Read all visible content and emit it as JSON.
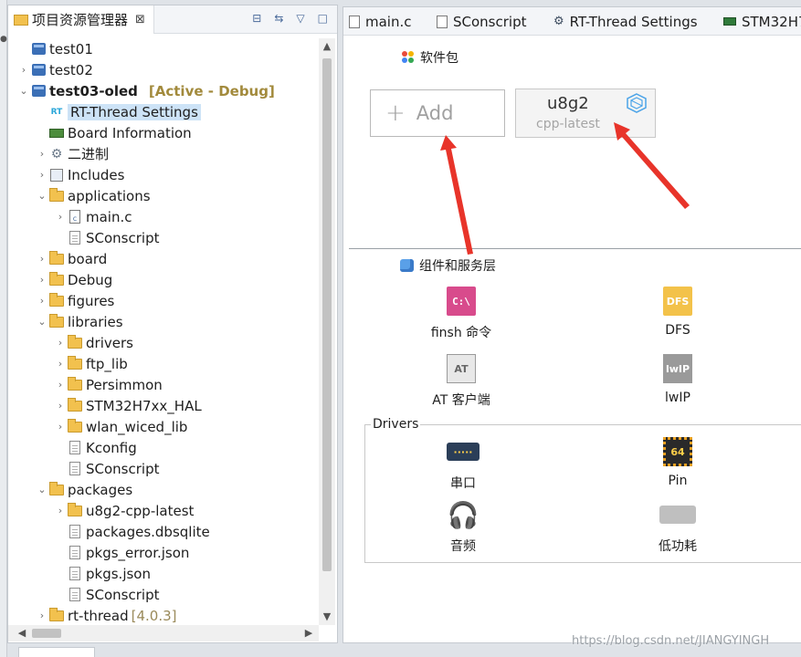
{
  "left_panel": {
    "tab_title": "项目资源管理器",
    "tab_close": "⊠",
    "tools": [
      "⊟",
      "⇆",
      "▽",
      "□"
    ],
    "tree": [
      {
        "label": "test01"
      },
      {
        "label": "test02"
      },
      {
        "label": "test03-oled",
        "suffix": "[Active - Debug]"
      },
      {
        "label": "RT-Thread Settings"
      },
      {
        "label": "Board Information"
      },
      {
        "label": "二进制"
      },
      {
        "label": "Includes"
      },
      {
        "label": "applications"
      },
      {
        "label": "main.c"
      },
      {
        "label": "SConscript"
      },
      {
        "label": "board"
      },
      {
        "label": "Debug"
      },
      {
        "label": "figures"
      },
      {
        "label": "libraries"
      },
      {
        "label": "drivers"
      },
      {
        "label": "ftp_lib"
      },
      {
        "label": "Persimmon"
      },
      {
        "label": "STM32H7xx_HAL"
      },
      {
        "label": "wlan_wiced_lib"
      },
      {
        "label": "Kconfig"
      },
      {
        "label": "SConscript"
      },
      {
        "label": "packages"
      },
      {
        "label": "u8g2-cpp-latest"
      },
      {
        "label": "packages.dbsqlite"
      },
      {
        "label": "pkgs_error.json"
      },
      {
        "label": "pkgs.json"
      },
      {
        "label": "SConscript"
      },
      {
        "label": "rt-thread",
        "version": "[4.0.3]"
      }
    ]
  },
  "right_panel": {
    "tabs": [
      "main.c",
      "SConscript",
      "RT-Thread Settings",
      "STM32H7"
    ],
    "software_section": "软件包",
    "add_label": "Add",
    "package": {
      "name": "u8g2",
      "version": "cpp-latest"
    },
    "components_section": "组件和服务层",
    "components": [
      {
        "label": "finsh 命令",
        "icon_text": "C:\\"
      },
      {
        "label": "DFS",
        "icon_text": "DFS"
      },
      {
        "label": "AT 客户端",
        "icon_text": "AT"
      },
      {
        "label": "lwIP",
        "icon_text": "lwIP"
      }
    ],
    "drivers_label": "Drivers",
    "drivers": [
      {
        "label": "串口",
        "icon_text": "·····"
      },
      {
        "label": "Pin",
        "icon_text": "64"
      },
      {
        "label": "音频",
        "icon_text": "🎧"
      },
      {
        "label": "低功耗",
        "icon_text": ""
      }
    ]
  },
  "watermark": "https://blog.csdn.net/JIANGYINGH",
  "colors": {
    "arrow": "#e8342a",
    "accent_selection": "#cde3f7",
    "active_tag": "#a28a3c"
  }
}
